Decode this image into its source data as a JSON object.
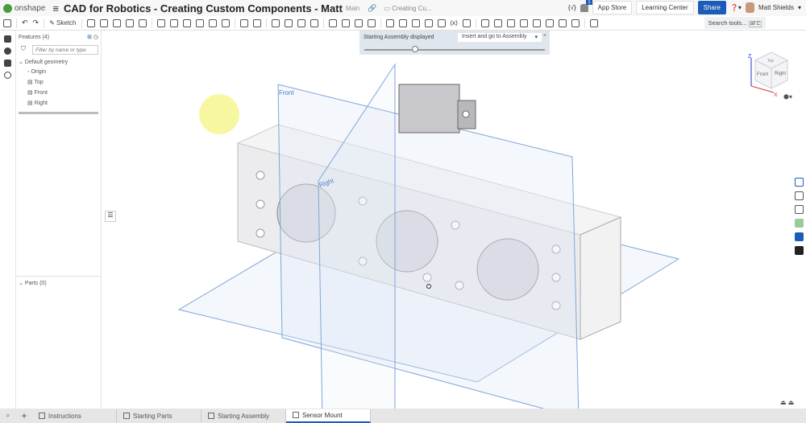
{
  "app": {
    "logo": "onshape",
    "title": "CAD for Robotics - Creating Custom Components - Matt",
    "branch": "Main",
    "folder": "Creating Cu..."
  },
  "header": {
    "notifications": "1",
    "app_store": "App Store",
    "learning_center": "Learning Center",
    "share": "Share",
    "user": "Matt Shields"
  },
  "toolbar": {
    "sketch": "Sketch",
    "search": "Search tools...",
    "shortcut": "alt C"
  },
  "features": {
    "title": "Features (4)",
    "filter_placeholder": "Filter by name or type",
    "group": "Default geometry",
    "items": [
      "Origin",
      "Top",
      "Front",
      "Right"
    ],
    "parts": "Parts (0)"
  },
  "notice": {
    "text": "Starting Assembly displayed",
    "select": "Insert and go to Assembly",
    "close": "×",
    "slider_value": 0.28
  },
  "viewport": {
    "plane_front": "Front",
    "plane_right": "Right",
    "cube": {
      "top": "Top",
      "front": "Front",
      "right": "Right",
      "x": "X",
      "z": "Z"
    }
  },
  "tabs": [
    "Instructions",
    "Starting Parts",
    "Starting Assembly",
    "Sensor Mount"
  ],
  "active_tab": "Sensor Mount",
  "colors": {
    "brand": "#1a5cb8",
    "plane": "#5b8fd6"
  }
}
